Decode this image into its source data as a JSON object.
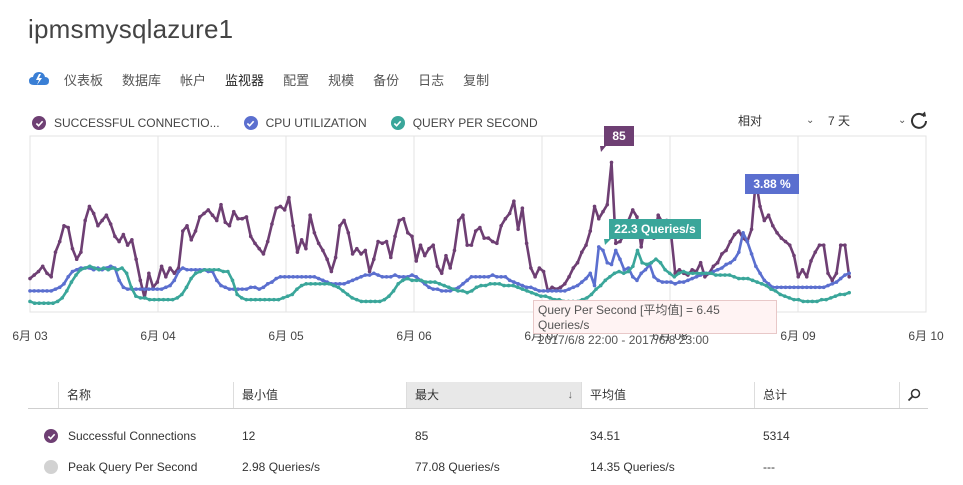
{
  "page_title": "ipmsmysqlazure1",
  "nav": {
    "items": [
      "仪表板",
      "数据库",
      "帐户",
      "监视器",
      "配置",
      "规模",
      "备份",
      "日志",
      "复制"
    ],
    "active_index": 3
  },
  "legend": [
    {
      "label": "SUCCESSFUL CONNECTIO...",
      "color": "#6e3f73"
    },
    {
      "label": "CPU UTILIZATION",
      "color": "#5b6fcf"
    },
    {
      "label": "QUERY PER SECOND",
      "color": "#3aa69a"
    }
  ],
  "selectors": {
    "mode": "相对",
    "range": "7 天"
  },
  "tooltip": {
    "line1": "Query Per Second [平均值] = 6.45 Queries/s",
    "line2": "2017/6/8 22:00 - 2017/6/8 23:00"
  },
  "callouts": {
    "successful_connections": "85",
    "cpu_utilization": "3.88 %",
    "query_per_second": "22.3 Queries/s"
  },
  "table": {
    "columns": [
      "名称",
      "最小值",
      "最大",
      "平均值",
      "总计"
    ],
    "sorted_column": "最大",
    "rows": [
      {
        "name": "Successful Connections",
        "min": "12",
        "max": "85",
        "avg": "34.51",
        "total": "5314",
        "checked": true,
        "color": "#6e3f73"
      },
      {
        "name": "Peak Query Per Second",
        "min": "2.98 Queries/s",
        "max": "77.08 Queries/s",
        "avg": "14.35 Queries/s",
        "total": "---",
        "checked": false,
        "color": "#d2d2d2"
      }
    ]
  },
  "chart_data": {
    "type": "line",
    "x_tick_labels": [
      "6月 03",
      "6月 04",
      "6月 05",
      "6月 06",
      "6月 07",
      "6月 08",
      "6月 09",
      "6月 10"
    ],
    "x_range": [
      0,
      7
    ],
    "y_range": [
      0,
      100
    ],
    "series": [
      {
        "name": "SUCCESSFUL CONNECTIO...",
        "color": "#6e3f73",
        "values": [
          19,
          21,
          23,
          26,
          22,
          20,
          34,
          40,
          49,
          48,
          36,
          30,
          34,
          52,
          60,
          56,
          49,
          52,
          55,
          50,
          43,
          40,
          44,
          38,
          41,
          30,
          18,
          8,
          22,
          14,
          17,
          26,
          20,
          25,
          22,
          25,
          46,
          49,
          41,
          46,
          54,
          56,
          58,
          55,
          52,
          61,
          51,
          49,
          57,
          53,
          53,
          54,
          43,
          39,
          36,
          33,
          40,
          50,
          59,
          60,
          58,
          65,
          49,
          34,
          41,
          36,
          55,
          45,
          39,
          35,
          30,
          23,
          31,
          49,
          52,
          45,
          33,
          36,
          33,
          35,
          23,
          30,
          40,
          39,
          40,
          31,
          43,
          52,
          53,
          45,
          43,
          29,
          38,
          32,
          36,
          38,
          26,
          22,
          32,
          25,
          35,
          52,
          55,
          38,
          38,
          46,
          48,
          42,
          42,
          40,
          39,
          49,
          53,
          56,
          63,
          47,
          59,
          39,
          25,
          20,
          25,
          23,
          12,
          14,
          13,
          14,
          16,
          20,
          25,
          28,
          34,
          38,
          46,
          60,
          53,
          57,
          61,
          85,
          39,
          40,
          44,
          52,
          58,
          54,
          37,
          51,
          51,
          42,
          55,
          51,
          52,
          45,
          22,
          24,
          22,
          21,
          24,
          23,
          28,
          20,
          22,
          26,
          28,
          33,
          35,
          40,
          44,
          46,
          42,
          40,
          47,
          75,
          60,
          52,
          55,
          49,
          45,
          42,
          40,
          38,
          32,
          20,
          24,
          20,
          29,
          34,
          38,
          38,
          22,
          18,
          22,
          38,
          38,
          20
        ]
      },
      {
        "name": "CPU UTILIZATION",
        "color": "#5b6fcf",
        "values": [
          12,
          12,
          12,
          12,
          12,
          12,
          13,
          14,
          16,
          20,
          23,
          24,
          25,
          25,
          25,
          24,
          25,
          24,
          25,
          26,
          25,
          18,
          14,
          13,
          13,
          13,
          13,
          13,
          13,
          13,
          13,
          13,
          14,
          15,
          18,
          23,
          25,
          24,
          24,
          24,
          24,
          24,
          23,
          23,
          18,
          15,
          14,
          13,
          13,
          13,
          13,
          13,
          14,
          14,
          13,
          14,
          16,
          17,
          19,
          20,
          20,
          20,
          20,
          20,
          20,
          20,
          20,
          20,
          19,
          18,
          17,
          16,
          16,
          16,
          16,
          17,
          18,
          19,
          20,
          21,
          21,
          22,
          21,
          20,
          20,
          20,
          21,
          20,
          20,
          20,
          21,
          20,
          18,
          16,
          14,
          13,
          13,
          12,
          12,
          12,
          13,
          14,
          16,
          18,
          20,
          20,
          20,
          20,
          20,
          21,
          20,
          20,
          20,
          18,
          17,
          16,
          15,
          14,
          14,
          13,
          12,
          12,
          12,
          12,
          12,
          12,
          12,
          13,
          14,
          15,
          17,
          19,
          22,
          15,
          37,
          35,
          28,
          27,
          35,
          30,
          24,
          25,
          20,
          18,
          22,
          24,
          27,
          20,
          18,
          17,
          17,
          17,
          16,
          17,
          17,
          18,
          19,
          20,
          21,
          22,
          22,
          23,
          24,
          25,
          27,
          28,
          30,
          34,
          45,
          40,
          33,
          26,
          22,
          18,
          16,
          14,
          14,
          14,
          14,
          14,
          14,
          14,
          14,
          14,
          14,
          14,
          14,
          14,
          15,
          16,
          17,
          19,
          21,
          22
        ]
      },
      {
        "name": "QUERY PER SECOND",
        "color": "#3aa69a",
        "values": [
          6,
          5,
          5,
          5,
          5,
          5,
          6,
          8,
          12,
          17,
          21,
          24,
          25,
          26,
          25,
          24,
          25,
          24,
          25,
          24,
          25,
          22,
          14,
          9,
          8,
          8,
          7,
          7,
          7,
          7,
          7,
          7,
          8,
          10,
          14,
          19,
          22,
          23,
          24,
          24,
          24,
          24,
          23,
          23,
          18,
          10,
          8,
          7,
          7,
          7,
          7,
          7,
          7,
          7,
          7,
          8,
          9,
          10,
          13,
          15,
          16,
          16,
          16,
          16,
          16,
          16,
          15,
          14,
          12,
          10,
          8,
          7,
          6,
          6,
          6,
          6,
          6,
          7,
          9,
          12,
          16,
          18,
          19,
          18,
          18,
          18,
          17,
          17,
          17,
          16,
          15,
          14,
          13,
          12,
          12,
          11,
          12,
          14,
          15,
          15,
          16,
          16,
          16,
          15,
          15,
          15,
          14,
          13,
          12,
          11,
          10,
          9,
          9,
          8,
          7,
          7,
          6,
          6,
          6,
          6,
          7,
          8,
          10,
          13,
          15,
          18,
          20,
          22,
          23,
          22,
          23,
          26,
          35,
          28,
          27,
          28,
          30,
          28,
          24,
          22,
          20,
          22,
          23,
          22,
          22,
          22,
          22,
          22,
          22,
          21,
          21,
          21,
          21,
          20,
          19,
          19,
          19,
          18,
          17,
          16,
          15,
          13,
          12,
          10,
          9,
          8,
          7,
          7,
          6,
          6,
          6,
          6,
          7,
          7,
          8,
          9,
          10,
          10,
          11
        ]
      }
    ]
  }
}
